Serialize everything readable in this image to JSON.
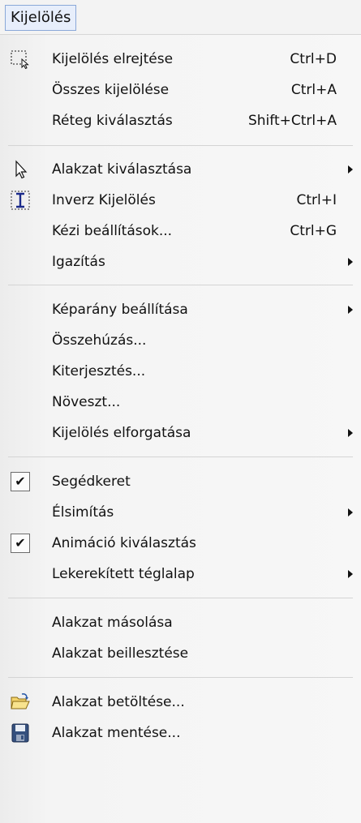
{
  "menubar": {
    "title": "Kijelölés"
  },
  "menu": {
    "items": [
      {
        "label": "Kijelölés elrejtése",
        "shortcut": "Ctrl+D",
        "icon": "dotted-selection-icon"
      },
      {
        "label": "Összes kijelölése",
        "shortcut": "Ctrl+A"
      },
      {
        "label": "Réteg kiválasztás",
        "shortcut": "Shift+Ctrl+A"
      },
      {
        "label": "Alakzat kiválasztása",
        "submenu": true,
        "icon": "pointer-icon"
      },
      {
        "label": "Inverz Kijelölés",
        "shortcut": "Ctrl+I",
        "icon": "text-cursor-icon"
      },
      {
        "label": "Kézi beállítások...",
        "shortcut": "Ctrl+G"
      },
      {
        "label": "Igazítás",
        "submenu": true
      },
      {
        "label": "Képarány beállítása",
        "submenu": true
      },
      {
        "label": "Összehúzás..."
      },
      {
        "label": "Kiterjesztés..."
      },
      {
        "label": "Növeszt..."
      },
      {
        "label": "Kijelölés elforgatása",
        "submenu": true
      },
      {
        "label": "Segédkeret",
        "checked": true
      },
      {
        "label": "Élsimítás",
        "submenu": true
      },
      {
        "label": "Animáció kiválasztás",
        "checked": true
      },
      {
        "label": "Lekerekített téglalap",
        "submenu": true
      },
      {
        "label": "Alakzat másolása"
      },
      {
        "label": "Alakzat beillesztése"
      },
      {
        "label": "Alakzat betöltése...",
        "icon": "open-folder-icon"
      },
      {
        "label": "Alakzat mentése...",
        "icon": "floppy-disk-icon"
      }
    ]
  },
  "colors": {
    "menu_title_bg": "#e7eefb",
    "menu_title_border": "#8aa8d8"
  }
}
